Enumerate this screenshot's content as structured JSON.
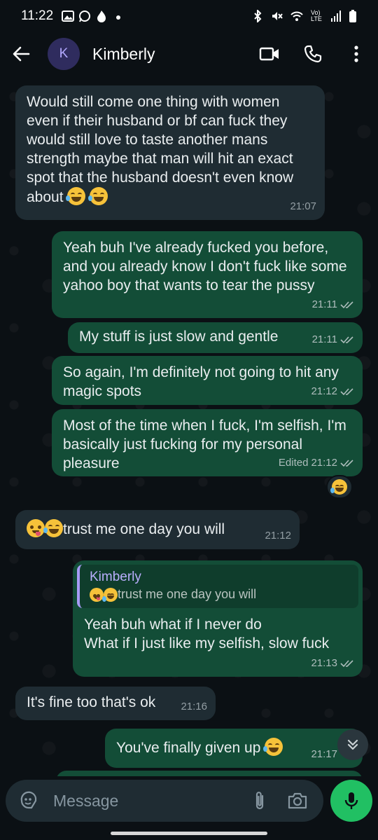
{
  "status_bar": {
    "time": "11:22",
    "network_label": "Vo) LTE"
  },
  "header": {
    "avatar_letter": "K",
    "contact_name": "Kimberly"
  },
  "messages": [
    {
      "direction": "in",
      "text": "Would still come one thing with women even if their husband or bf can fuck they would still love to taste another mans strength maybe that man will hit an exact spot that the husband doesn't even know about",
      "time": "21:07"
    },
    {
      "direction": "out",
      "text": "Yeah buh I've already fucked you before, and you already know I don't fuck like some yahoo boy that wants to tear the pussy",
      "time": "21:11"
    },
    {
      "direction": "out",
      "text": "My stuff is just slow and gentle",
      "time": "21:11"
    },
    {
      "direction": "out",
      "text": "So again, I'm definitely not going to hit any magic spots",
      "time": "21:12"
    },
    {
      "direction": "out",
      "text": "Most of the time when I fuck, I'm selfish, I'm basically just fucking for my personal pleasure",
      "time": "21:12",
      "edited_label": "Edited"
    },
    {
      "direction": "in",
      "text": "trust me one day you will",
      "time": "21:12"
    },
    {
      "direction": "out",
      "reply_to_name": "Kimberly",
      "reply_to_text": "trust me one day you will",
      "text_line1": "Yeah buh what if I never do",
      "text_line2": "What if I just like my selfish, slow fuck",
      "time": "21:13"
    },
    {
      "direction": "in",
      "text": "It's fine too that's ok",
      "time": "21:16"
    },
    {
      "direction": "out",
      "text": "You've finally given up",
      "time": "21:17"
    }
  ],
  "composer": {
    "placeholder": "Message"
  },
  "colors": {
    "background": "#0b1014",
    "incoming_bubble": "#1f2c33",
    "outgoing_bubble": "#134d37",
    "accent_green": "#21c063"
  }
}
